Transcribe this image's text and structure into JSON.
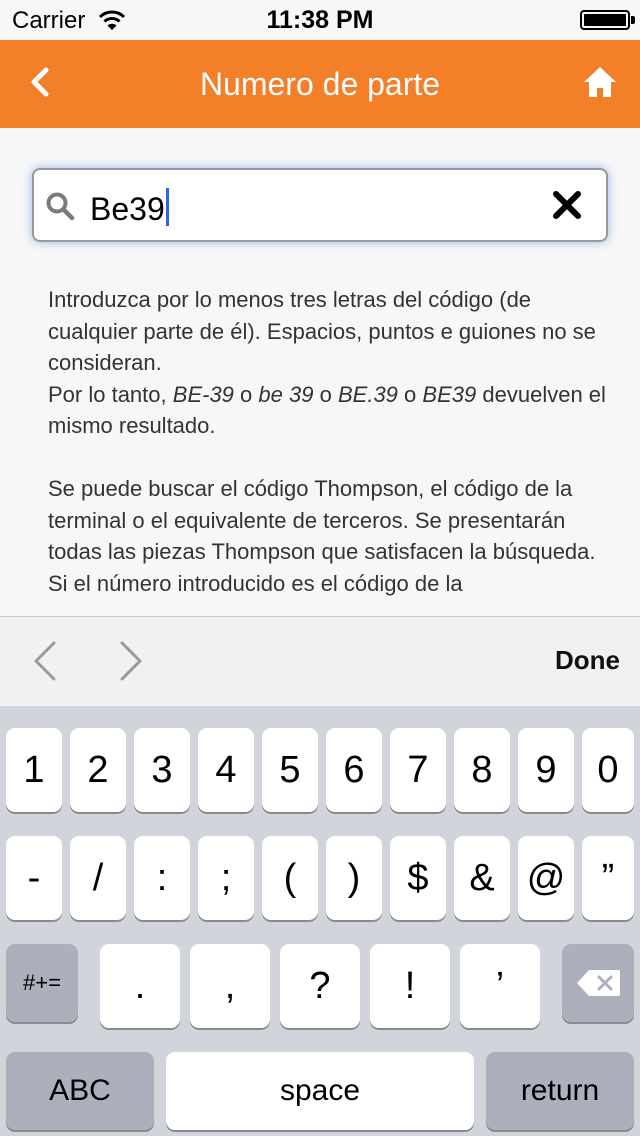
{
  "status_bar": {
    "carrier": "Carrier",
    "time": "11:38 PM"
  },
  "nav": {
    "title": "Numero de parte"
  },
  "search": {
    "value": "Be39"
  },
  "help": {
    "p1": "Introduzca por lo menos tres letras del código (de cualquier parte de él). Espacios, puntos e guiones no se consideran.",
    "p2_prefix": "Por lo tanto,",
    "ex1": "BE-39",
    "or1": "o",
    "ex2": "be 39",
    "or2": "o",
    "ex3": "BE.39",
    "or3": "o",
    "ex4": "BE39",
    "p2_suffix": "devuelven el mismo resultado.",
    "p3": "Se puede buscar el código Thompson, el código de la terminal o el equivalente de terceros. Se presentarán todas las piezas Thompson que satisfacen la búsqueda.",
    "p4": "Si el número introducido es el código de la"
  },
  "accessory": {
    "done": "Done"
  },
  "keyboard": {
    "row1": [
      "1",
      "2",
      "3",
      "4",
      "5",
      "6",
      "7",
      "8",
      "9",
      "0"
    ],
    "row2": [
      "-",
      "/",
      ":",
      ";",
      "(",
      ")",
      "$",
      "&",
      "@",
      "”"
    ],
    "row3": [
      ".",
      ",",
      "?",
      "!",
      "’"
    ],
    "symbols": "#+=",
    "abc": "ABC",
    "space": "space",
    "return": "return"
  }
}
